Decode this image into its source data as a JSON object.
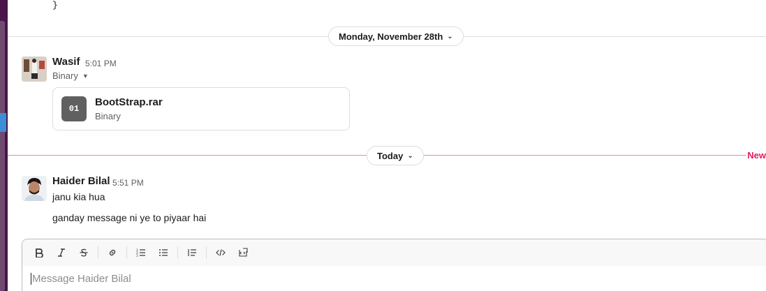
{
  "code_tail": "}",
  "dividers": {
    "date_label": "Monday, November 28th",
    "today_label": "Today",
    "new_label": "New"
  },
  "messages": [
    {
      "author": "Wasif",
      "time": "5:01 PM",
      "sublabel": "Binary",
      "file": {
        "icon_text": "01",
        "name": "BootStrap.rar",
        "type": "Binary"
      }
    },
    {
      "author": "Haider Bilal",
      "time": "5:51 PM",
      "lines": [
        "janu kia hua",
        "ganday message ni ye to piyaar hai"
      ]
    }
  ],
  "composer": {
    "placeholder": "Message Haider Bilal",
    "toolbar": [
      "bold-icon",
      "italic-icon",
      "strikethrough-icon",
      "link-icon",
      "ordered-list-icon",
      "bulleted-list-icon",
      "blockquote-icon",
      "code-icon",
      "code-block-icon"
    ]
  },
  "colors": {
    "accent_new": "#e01e5a",
    "sidebar": "#4a154b",
    "text": "#1d1c1d",
    "muted": "#616061"
  }
}
